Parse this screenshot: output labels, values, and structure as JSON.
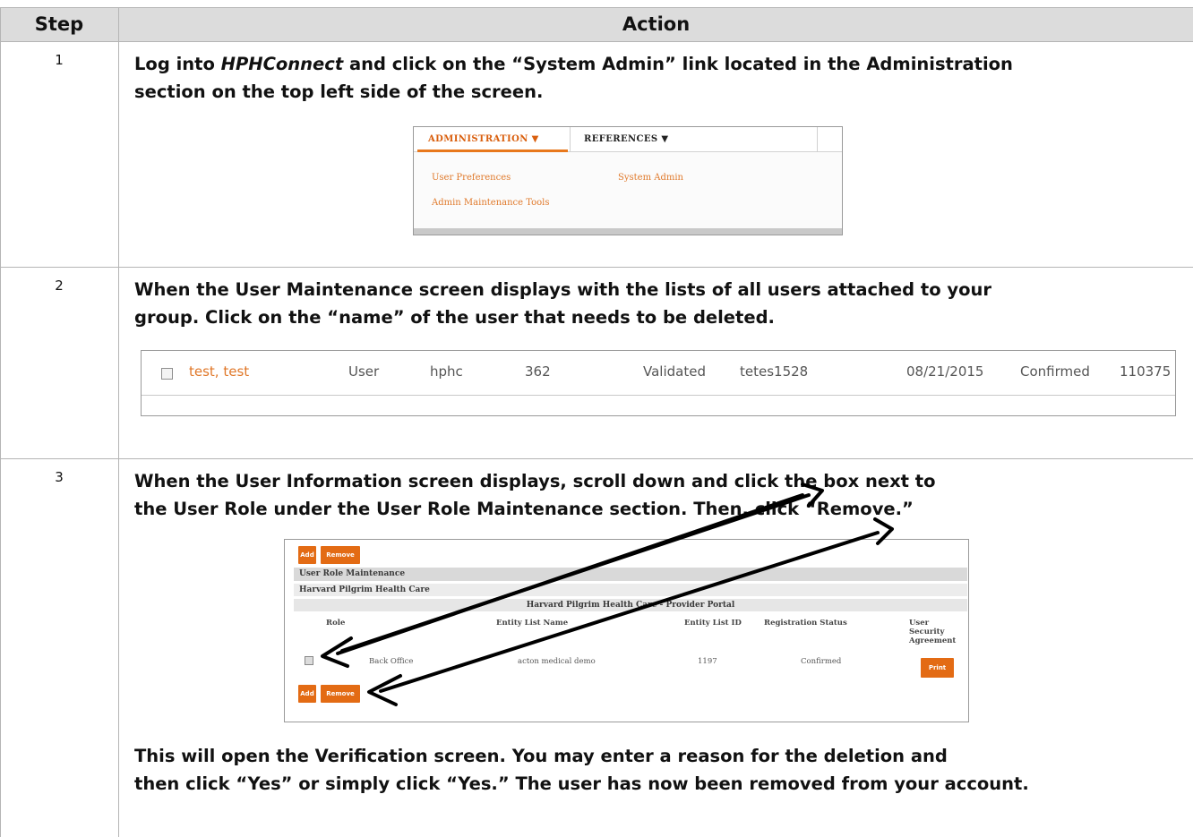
{
  "table": {
    "headers": {
      "step": "Step",
      "action": "Action"
    },
    "rows": [
      {
        "step": "1",
        "text_before": "Log into ",
        "text_em": "HPHConnect",
        "text_after": " and click on the “System Admin” link located in the Administration",
        "text_line2": "section on the top left side of the screen."
      },
      {
        "step": "2",
        "text_line1": "When the User Maintenance screen displays with the lists of all users attached to your",
        "text_line2": "group. Click on the “name” of the user that needs to be deleted."
      },
      {
        "step": "3",
        "text_line1": "When the User Information screen displays, scroll down and click the box next to",
        "text_line2": "the User Role under the User Role Maintenance section. Then, click “Remove.”",
        "after_line1": "This will open the Verification screen. You may enter a reason for the deletion and",
        "after_line2": "then click “Yes” or simply click “Yes.” The user has now been removed from your account."
      }
    ]
  },
  "screenshot_menu": {
    "tabs": [
      "ADMINISTRATION ▼",
      "REFERENCES ▼"
    ],
    "links": [
      "User Preferences",
      "System Admin",
      "Admin Maintenance Tools"
    ]
  },
  "screenshot_user_row": {
    "name": "test, test",
    "role": "User",
    "group": "hphc",
    "number": "362",
    "status": "Validated",
    "username": "tetes1528",
    "date": "08/21/2015",
    "confirmation": "Confirmed",
    "id": "110375"
  },
  "screenshot_role": {
    "add_label": "Add",
    "remove_label": "Remove",
    "section_title": "User Role Maintenance",
    "org": "Harvard Pilgrim Health Care",
    "portal": "Harvard Pilgrim Health Care - Provider Portal",
    "columns": {
      "role": "Role",
      "entity_list_name": "Entity List Name",
      "entity_list_id": "Entity List ID",
      "registration_status": "Registration Status",
      "agreement_l1": "User",
      "agreement_l2": "Security",
      "agreement_l3": "Agreement"
    },
    "row": {
      "role": "Back Office",
      "entity_list_name": "acton medical demo",
      "entity_list_id": "1197",
      "registration_status": "Confirmed",
      "print_label": "Print"
    }
  },
  "colors": {
    "accent_orange": "#e36b14",
    "header_gray": "#dcdcdc",
    "border_gray": "#b5b5b5"
  },
  "icons": [
    "checkbox-icon",
    "arrow-icon"
  ]
}
